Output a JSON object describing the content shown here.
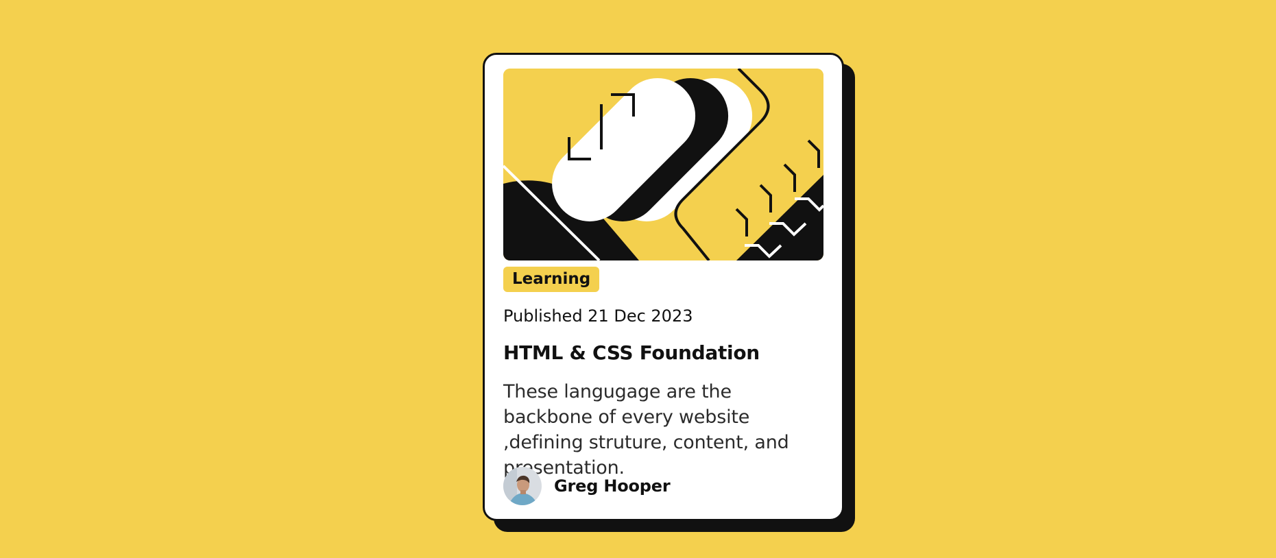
{
  "card": {
    "tag": "Learning",
    "published": "Published 21 Dec 2023",
    "title": "HTML & CSS Foundation",
    "description": "These langugage are the backbone of every website ,defining struture, content, and presentation.",
    "author": {
      "name": "Greg Hooper",
      "avatar": "person-avatar"
    }
  },
  "colors": {
    "background": "#f4d04e",
    "card": "#ffffff",
    "ink": "#111111"
  },
  "icons": {
    "hero": "code-illustration"
  }
}
